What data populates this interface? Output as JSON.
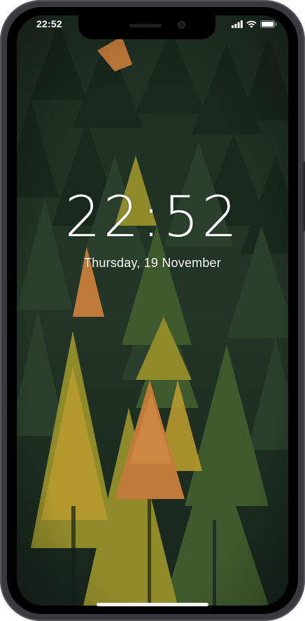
{
  "status_bar": {
    "time": "22:52",
    "icons": [
      "signal-icon",
      "wifi-icon",
      "battery-icon"
    ]
  },
  "lock_screen": {
    "time": "22:52",
    "date": "Thursday, 19 November"
  },
  "wallpaper": {
    "subject": "forest-wallpaper",
    "colors": {
      "dark_green": "#1f3324",
      "green": "#3f5a2a",
      "olive": "#8a8a2a",
      "gold": "#b7952b",
      "orange": "#c2773a"
    }
  },
  "device": {
    "frame_color": "#3a3940"
  }
}
